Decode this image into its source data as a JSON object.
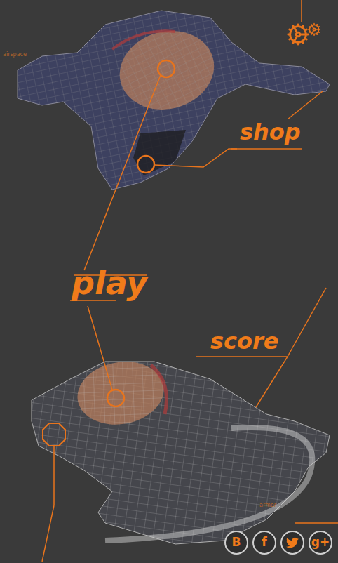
{
  "tags": {
    "top": "airspace",
    "bottom": "armor"
  },
  "menu": [
    {
      "label": "shop"
    },
    {
      "label": "play"
    },
    {
      "label": "score"
    }
  ],
  "social": [
    {
      "kind": "text",
      "label": "B"
    },
    {
      "kind": "text",
      "label": "f"
    },
    {
      "kind": "twitter"
    },
    {
      "kind": "text",
      "label": "g+"
    }
  ]
}
